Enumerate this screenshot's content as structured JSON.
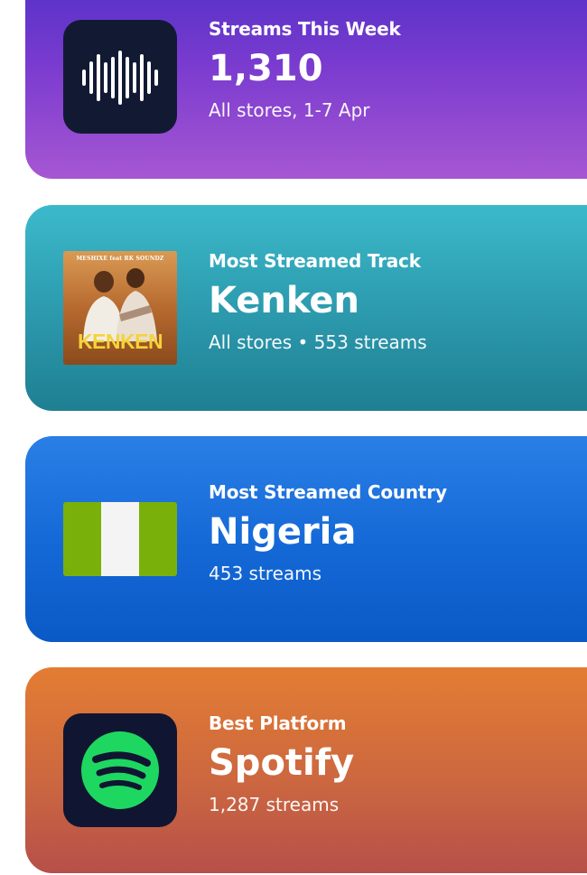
{
  "cards": [
    {
      "label": "Streams This Week",
      "headline": "1,310",
      "sub": "All stores, 1-7 Apr",
      "icon": "waveform-icon"
    },
    {
      "label": "Most Streamed Track",
      "headline": "Kenken",
      "sub": "All stores • 553 streams",
      "icon": "album-cover",
      "cover": {
        "header": "MESHIXE feat RK SOUNDZ",
        "title": "KENKEN"
      }
    },
    {
      "label": "Most Streamed Country",
      "headline": "Nigeria",
      "sub": "453 streams",
      "icon": "nigeria-flag"
    },
    {
      "label": "Best Platform",
      "headline": "Spotify",
      "sub": "1,287 streams",
      "icon": "spotify-icon"
    }
  ],
  "colors": {
    "streams_card": "#7a3bcf",
    "track_card": "#2a95a9",
    "country_card": "#1468d6",
    "platform_card": "#cc6740",
    "spotify_green": "#1ed760",
    "flag_green": "#79b10a"
  }
}
